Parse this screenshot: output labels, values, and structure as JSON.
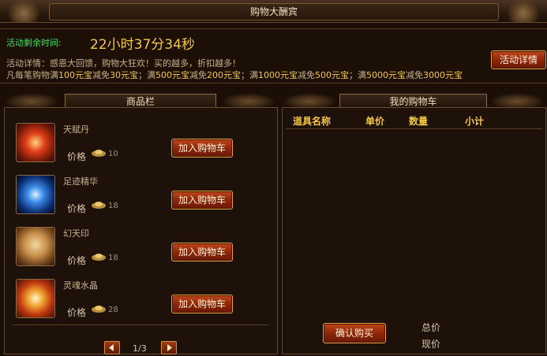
{
  "window": {
    "title": "购物大酬宾"
  },
  "event": {
    "timer_label": "活动剩余时间:",
    "timer_value": "22小时37分34秒",
    "description": "活动详情：感恩大回馈，购物大狂欢！买的越多，折扣越多！",
    "rules_prefix": "凡每笔购物满",
    "rules": [
      {
        "threshold": "100元宝",
        "mid": "减免",
        "discount": "30元宝",
        "sep": "；满"
      },
      {
        "threshold": "500元宝",
        "mid": "减免",
        "discount": "200元宝",
        "sep": "；满"
      },
      {
        "threshold": "1000元宝",
        "mid": "减免",
        "discount": "500元宝",
        "sep": "；满"
      },
      {
        "threshold": "5000元宝",
        "mid": "减免",
        "discount": "3000元宝",
        "sep": ""
      }
    ],
    "detail_button": "活动详情"
  },
  "goods": {
    "tab_label": "商品栏",
    "price_label": "价格",
    "add_button": "加入购物车",
    "items": [
      {
        "name": "天赋丹",
        "price": "10",
        "icon": "red-gem-icon",
        "color": "#d2381a"
      },
      {
        "name": "足迹精华",
        "price": "18",
        "icon": "blue-orb-icon",
        "color": "#2a7ae0"
      },
      {
        "name": "幻天印",
        "price": "18",
        "icon": "seal-box-icon",
        "color": "#c89a5a"
      },
      {
        "name": "灵魂水晶",
        "price": "28",
        "icon": "fire-crystal-icon",
        "color": "#e06a1a"
      }
    ],
    "pager": {
      "text": "1/3"
    }
  },
  "cart": {
    "tab_label": "我的购物车",
    "columns": [
      "道具名称",
      "单价",
      "数量",
      "小计"
    ],
    "confirm_button": "确认购买",
    "total_label": "总价",
    "now_label": "现价"
  },
  "colors": {
    "accent_green": "#39e15a",
    "accent_gold": "#f5c842",
    "button_red": "#8a2408"
  }
}
